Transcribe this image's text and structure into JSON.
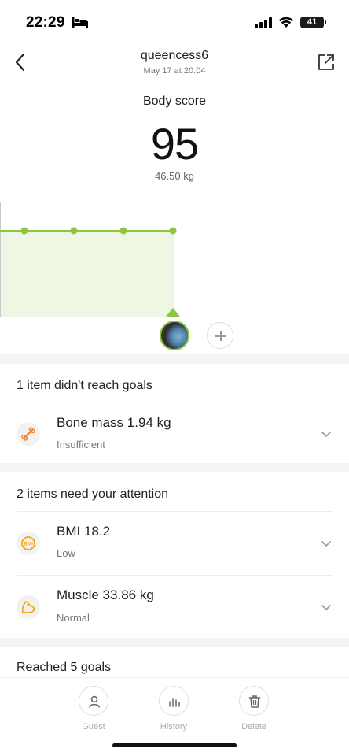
{
  "status_bar": {
    "time": "22:29",
    "battery": "41",
    "icons": [
      "bed-icon",
      "cellular-signal-icon",
      "wifi-icon",
      "battery-icon"
    ]
  },
  "header": {
    "title": "queencess6",
    "subtitle": "May 17 at 20:04",
    "back_icon": "chevron-left-icon",
    "share_icon": "share-external-icon"
  },
  "score": {
    "label": "Body score",
    "value": "95",
    "weight": "46.50 kg"
  },
  "colors": {
    "accent_green": "#8dc63f",
    "chart_fill": "#eef7e3",
    "bone_icon": "#f08a3c",
    "bmi_icon": "#f2a814",
    "muscle_icon": "#f2a814"
  },
  "chart_data": {
    "type": "line",
    "series": [
      {
        "values": [
          95,
          95,
          95,
          95,
          95
        ]
      }
    ],
    "selected_index": 4
  },
  "sections": [
    {
      "header": "1 item didn't reach goals",
      "items": [
        {
          "name": "Bone mass",
          "value": "1.94 kg",
          "status": "Insufficient",
          "icon": "bone-icon"
        }
      ]
    },
    {
      "header": "2 items need your attention",
      "items": [
        {
          "name": "BMI",
          "value": "18.2",
          "status": "Low",
          "icon": "bmi-icon"
        },
        {
          "name": "Muscle",
          "value": "33.86 kg",
          "status": "Normal",
          "icon": "muscle-icon"
        }
      ]
    },
    {
      "header": "Reached 5 goals",
      "items": []
    }
  ],
  "bottom_bar": {
    "guest_label": "Guest",
    "history_label": "History",
    "delete_label": "Delete"
  },
  "bmi_badge": "BMI"
}
